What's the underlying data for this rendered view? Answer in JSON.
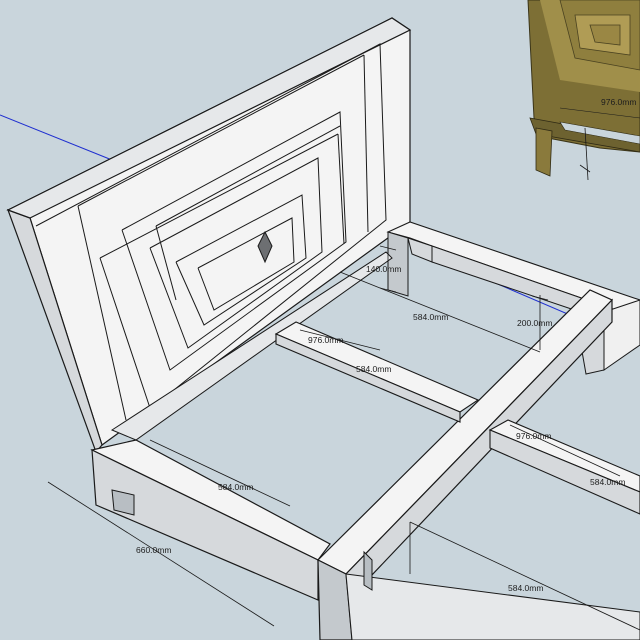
{
  "dimensions": [
    {
      "id": "headboard-leg-height",
      "text": "140.0mm"
    },
    {
      "id": "rail-gap-upper",
      "text": "584.0mm"
    },
    {
      "id": "rail-drop",
      "text": "200.0mm"
    },
    {
      "id": "slat-length-a",
      "text": "976.0mm"
    },
    {
      "id": "slat-spacing-a",
      "text": "584.0mm"
    },
    {
      "id": "slat-length-b",
      "text": "976.0mm"
    },
    {
      "id": "slat-spacing-right",
      "text": "584.0mm"
    },
    {
      "id": "side-rail-span",
      "text": "584.0mm"
    },
    {
      "id": "side-rail-length",
      "text": "660.0mm"
    },
    {
      "id": "lower-span",
      "text": "584.0mm"
    },
    {
      "id": "inset-width",
      "text": "976.0mm"
    }
  ],
  "colors": {
    "background": "#c9d5dc",
    "wood_face": "#f4f4f4",
    "wood_side": "#d6d9dc",
    "wood_shadow": "#b8bec3",
    "edge": "#1a1a1a",
    "axis_blue": "#1f2fd0",
    "photo_wood": "#8a7a3c"
  }
}
